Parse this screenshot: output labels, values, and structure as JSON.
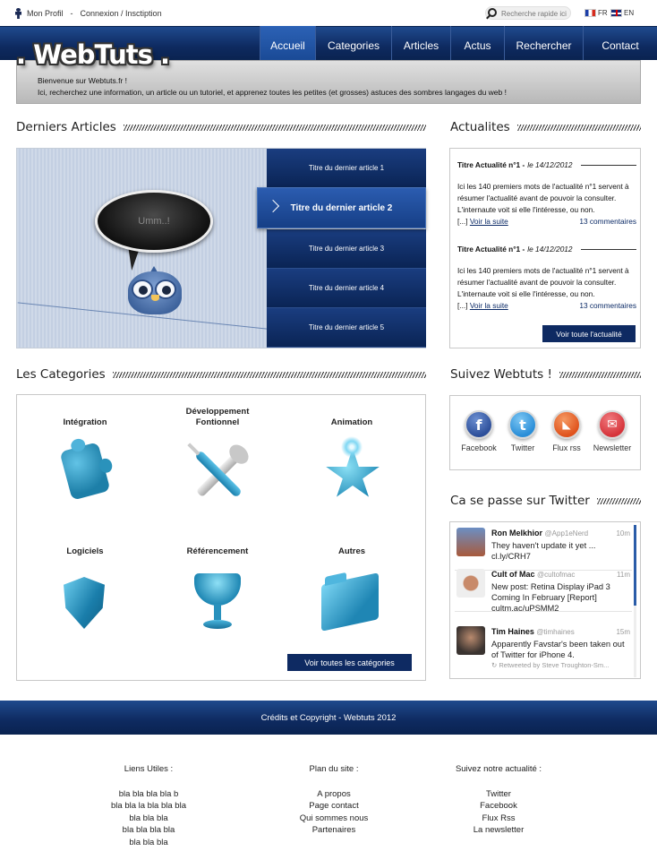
{
  "topbar": {
    "profile_label": "Mon Profil",
    "separator": "-",
    "login_label": "Connexion / Insctiption",
    "search_placeholder": "Recherche rapide ici",
    "lang_fr": "FR",
    "lang_en": "EN"
  },
  "logo": ". WebTuts .",
  "nav": [
    "Accueil",
    "Categories",
    "Articles",
    "Actus",
    "Rechercher",
    "Contact"
  ],
  "welcome": {
    "line1": "Bienvenue sur Webtuts.fr !",
    "line2": "Ici, recherchez une information, un article ou un tutoriel, et apprenez toutes les petites (et grosses) astuces des sombres langages du web !"
  },
  "sections": {
    "articles": "Derniers Articles",
    "news": "Actualites",
    "categories": "Les Categories",
    "follow": "Suivez Webtuts !",
    "twitter": "Ca se passe sur Twitter"
  },
  "slider": {
    "bubble_text": "Umm..!",
    "articles": [
      "Titre du dernier article 1",
      "Titre du dernier article 2",
      "Titre du dernier article 3",
      "Titre du dernier article 4",
      "Titre du dernier article 5"
    ]
  },
  "news": {
    "items": [
      {
        "title": "Titre Actualité n°1 -",
        "date": "le 14/12/2012",
        "body": "Ici les 140 premiers mots de l'actualité n°1 servent à résumer l'actualité avant de pouvoir la consulter. L'internaute voit si elle l'intéresse, ou non.",
        "ellipsis": "[...]",
        "read_more": "Voir la suite",
        "comments": "13 commentaires"
      },
      {
        "title": "Titre Actualité n°1 -",
        "date": "le 14/12/2012",
        "body": "Ici les 140 premiers mots de l'actualité n°1 servent à résumer l'actualité avant de pouvoir la consulter. L'internaute voit si elle l'intéresse, ou non.",
        "ellipsis": "[...]",
        "read_more": "Voir la suite",
        "comments": "13 commentaires"
      }
    ],
    "all_button": "Voir toute l'actualité"
  },
  "categories": {
    "items": [
      {
        "label": "Intégration",
        "icon": "puzzle-icon"
      },
      {
        "label": "Développement Fontionnel",
        "icon": "tools-icon"
      },
      {
        "label": "Animation",
        "icon": "star-icon"
      },
      {
        "label": "Logiciels",
        "icon": "shield-icon"
      },
      {
        "label": "Référencement",
        "icon": "trophy-icon"
      },
      {
        "label": "Autres",
        "icon": "folder-icon"
      }
    ],
    "all_button": "Voir toutes les catégories"
  },
  "social": [
    {
      "label": "Facebook",
      "glyph": "f",
      "color": "#2d4f9a"
    },
    {
      "label": "Twitter",
      "glyph": "t",
      "color": "#2a8ed8"
    },
    {
      "label": "Flux rss",
      "glyph": "◣",
      "color": "#e0531d"
    },
    {
      "label": "Newsletter",
      "glyph": "✉",
      "color": "#d6343b"
    }
  ],
  "tweets": [
    {
      "name": "Ron Melkhior",
      "handle": "@App1eNerd",
      "time": "10m",
      "text": "They haven't update it yet ... cl.ly/CRH7",
      "retweet": ""
    },
    {
      "name": "Cult of Mac",
      "handle": "@cultofmac",
      "time": "11m",
      "text": "New post: Retina Display iPad 3 Coming In February [Report] cultm.ac/uPSMM2",
      "retweet": ""
    },
    {
      "name": "Tim Haines",
      "handle": "@timhaines",
      "time": "15m",
      "text": "Apparently Favstar's been taken out of Twitter for iPhone 4.",
      "retweet": "Retweeted by Steve Troughton-Sm..."
    }
  ],
  "footer": {
    "copyright": "Crédits et Copyright - Webtuts 2012",
    "columns": [
      {
        "title": "Liens Utiles :",
        "links": [
          "bla bla bla bla b",
          "bla bla la bla bla bla",
          "bla bla bla",
          "bla bla bla bla",
          "bla bla bla"
        ]
      },
      {
        "title": "Plan du site :",
        "links": [
          "A propos",
          "Page contact",
          "Qui sommes nous",
          "Partenaires"
        ]
      },
      {
        "title": "Suivez notre actualité :",
        "links": [
          "Twitter",
          "Facebook",
          "Flux Rss",
          "La newsletter"
        ]
      }
    ]
  }
}
